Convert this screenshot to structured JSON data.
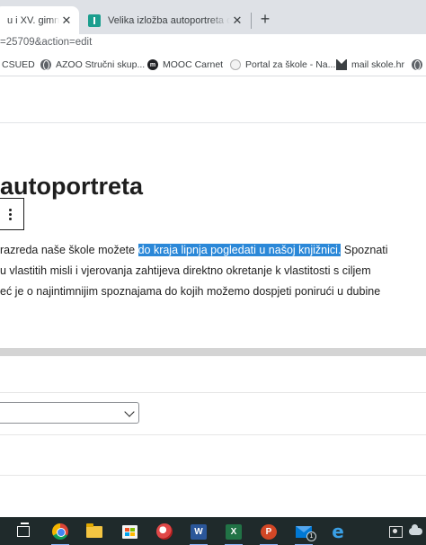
{
  "browser": {
    "tabs": [
      {
        "title": "u i XV. gimnazij",
        "active": true
      },
      {
        "title": "Velika izložba autoportreta otkriv",
        "active": false
      }
    ],
    "tab_close_glyph": "✕",
    "new_tab_glyph": "+",
    "address": {
      "url": "=25709&action=edit"
    },
    "bookmarks": [
      {
        "label": "CSUED",
        "icon": "globe-icon"
      },
      {
        "label": "AZOO Stručni skup...",
        "icon": "globe-icon"
      },
      {
        "label": "MOOC Carnet",
        "icon": "mooc-icon"
      },
      {
        "label": "Portal za škole - Na...",
        "icon": "portal-icon"
      },
      {
        "label": "mail skole.hr",
        "icon": "mail-icon"
      }
    ]
  },
  "editor": {
    "post_title": "autoportreta",
    "paragraph": {
      "line1_before": "razreda naše škole možete ",
      "line1_highlight": "do kraja lipnja pogledati u našoj knjižnici.",
      "line1_after": " Spoznati",
      "line2": "u vlastitih misli i vjerovanja zahtijeva direktno okretanje k vlastitosti s ciljem",
      "line3": "eć je o najintimnijim spoznajama do kojih možemo dospjeti ponirući u dubine"
    },
    "highlight_color": "#2b88d8"
  },
  "taskbar": {
    "mail_badge": "1",
    "icons": [
      "task-view-icon",
      "chrome-icon",
      "file-explorer-icon",
      "store-icon",
      "snip-icon",
      "word-icon",
      "excel-icon",
      "powerpoint-icon",
      "mail-icon",
      "edge-icon"
    ],
    "office_letters": {
      "word": "W",
      "excel": "X",
      "powerpoint": "P"
    },
    "edge_glyph": "e"
  }
}
